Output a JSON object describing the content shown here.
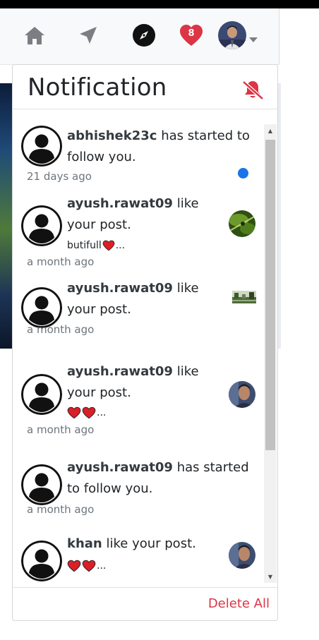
{
  "navbar": {
    "badge_count": "8",
    "icons": [
      "home-icon",
      "send-icon",
      "compass-icon",
      "heart-icon",
      "avatar",
      "caret-down-icon"
    ],
    "colors": {
      "heart_badge": "#dc3545",
      "accent": "#1a73e8",
      "danger": "#dc3545"
    }
  },
  "panel": {
    "title": "Notification",
    "mute_icon": "bell-slash-icon",
    "delete_all": "Delete All"
  },
  "notifications": [
    {
      "user": "abhishek23c",
      "action": "has started to follow you.",
      "time": "21 days ago",
      "unread": true
    },
    {
      "user": "ayush.rawat09",
      "action": "like your post.",
      "caption": "butifull",
      "caption_suffix": "...",
      "time": "a month ago",
      "thumbnail": "green-leaf"
    },
    {
      "user": "ayush.rawat09",
      "action": "like your post.",
      "time": "a month ago",
      "thumbnail": "landscape"
    },
    {
      "user": "ayush.rawat09",
      "action": "like your post.",
      "caption_suffix": "...",
      "time": "a month ago",
      "thumbnail": "portrait"
    },
    {
      "user": "ayush.rawat09",
      "action": "has started to follow you.",
      "time": "a month ago"
    },
    {
      "user": "khan",
      "action": "like your post.",
      "caption_suffix": "...",
      "thumbnail": "portrait"
    }
  ]
}
